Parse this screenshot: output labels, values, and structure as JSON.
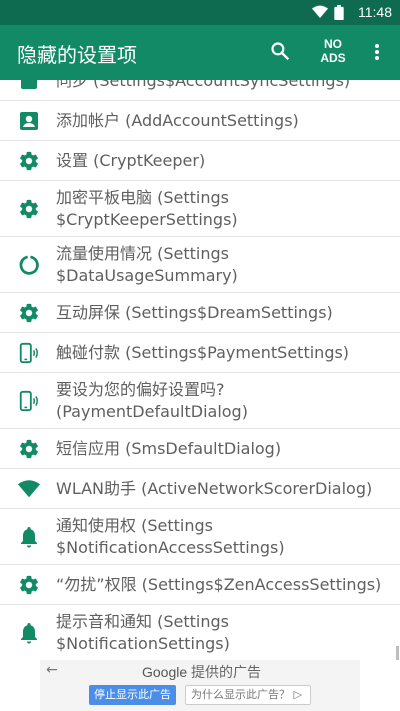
{
  "status_bar": {
    "time": "11:48"
  },
  "app_bar": {
    "title": "隐藏的设置项",
    "no_ads_line1": "NO",
    "no_ads_line2": "ADS"
  },
  "colors": {
    "status_bar": "#0e6b4f",
    "app_bar": "#128a65",
    "icon": "#128a65",
    "text": "#5f5f5f"
  },
  "list": [
    {
      "icon": "sync-icon",
      "label": "同步 (Settings$AccountSyncSettings)"
    },
    {
      "icon": "account-box-icon",
      "label": "添加帐户 (AddAccountSettings)"
    },
    {
      "icon": "gear-icon",
      "label": "设置 (CryptKeeper)"
    },
    {
      "icon": "gear-icon",
      "label": "加密平板电脑 (Settings $CryptKeeperSettings)"
    },
    {
      "icon": "data-usage-icon",
      "label": "流量使用情况 (Settings $DataUsageSummary)"
    },
    {
      "icon": "gear-icon",
      "label": "互动屏保 (Settings$DreamSettings)"
    },
    {
      "icon": "nfc-phone-icon",
      "label": "触碰付款 (Settings$PaymentSettings)"
    },
    {
      "icon": "nfc-phone-icon",
      "label": "要设为您的偏好设置吗? (PaymentDefaultDialog)"
    },
    {
      "icon": "gear-icon",
      "label": "短信应用 (SmsDefaultDialog)"
    },
    {
      "icon": "wifi-icon",
      "label": "WLAN助手 (ActiveNetworkScorerDialog)"
    },
    {
      "icon": "bell-icon",
      "label": "通知使用权 (Settings $NotificationAccessSettings)"
    },
    {
      "icon": "gear-icon",
      "label": "“勿扰”权限 (Settings$ZenAccessSettings)"
    },
    {
      "icon": "bell-icon",
      "label": "提示音和通知 (Settings $NotificationSettings)"
    }
  ],
  "ad": {
    "back": "←",
    "google": "Google",
    "provided": "提供的广告",
    "stop_button": "停止显示此广告",
    "why_button": "为什么显示此广告？ ▷"
  }
}
